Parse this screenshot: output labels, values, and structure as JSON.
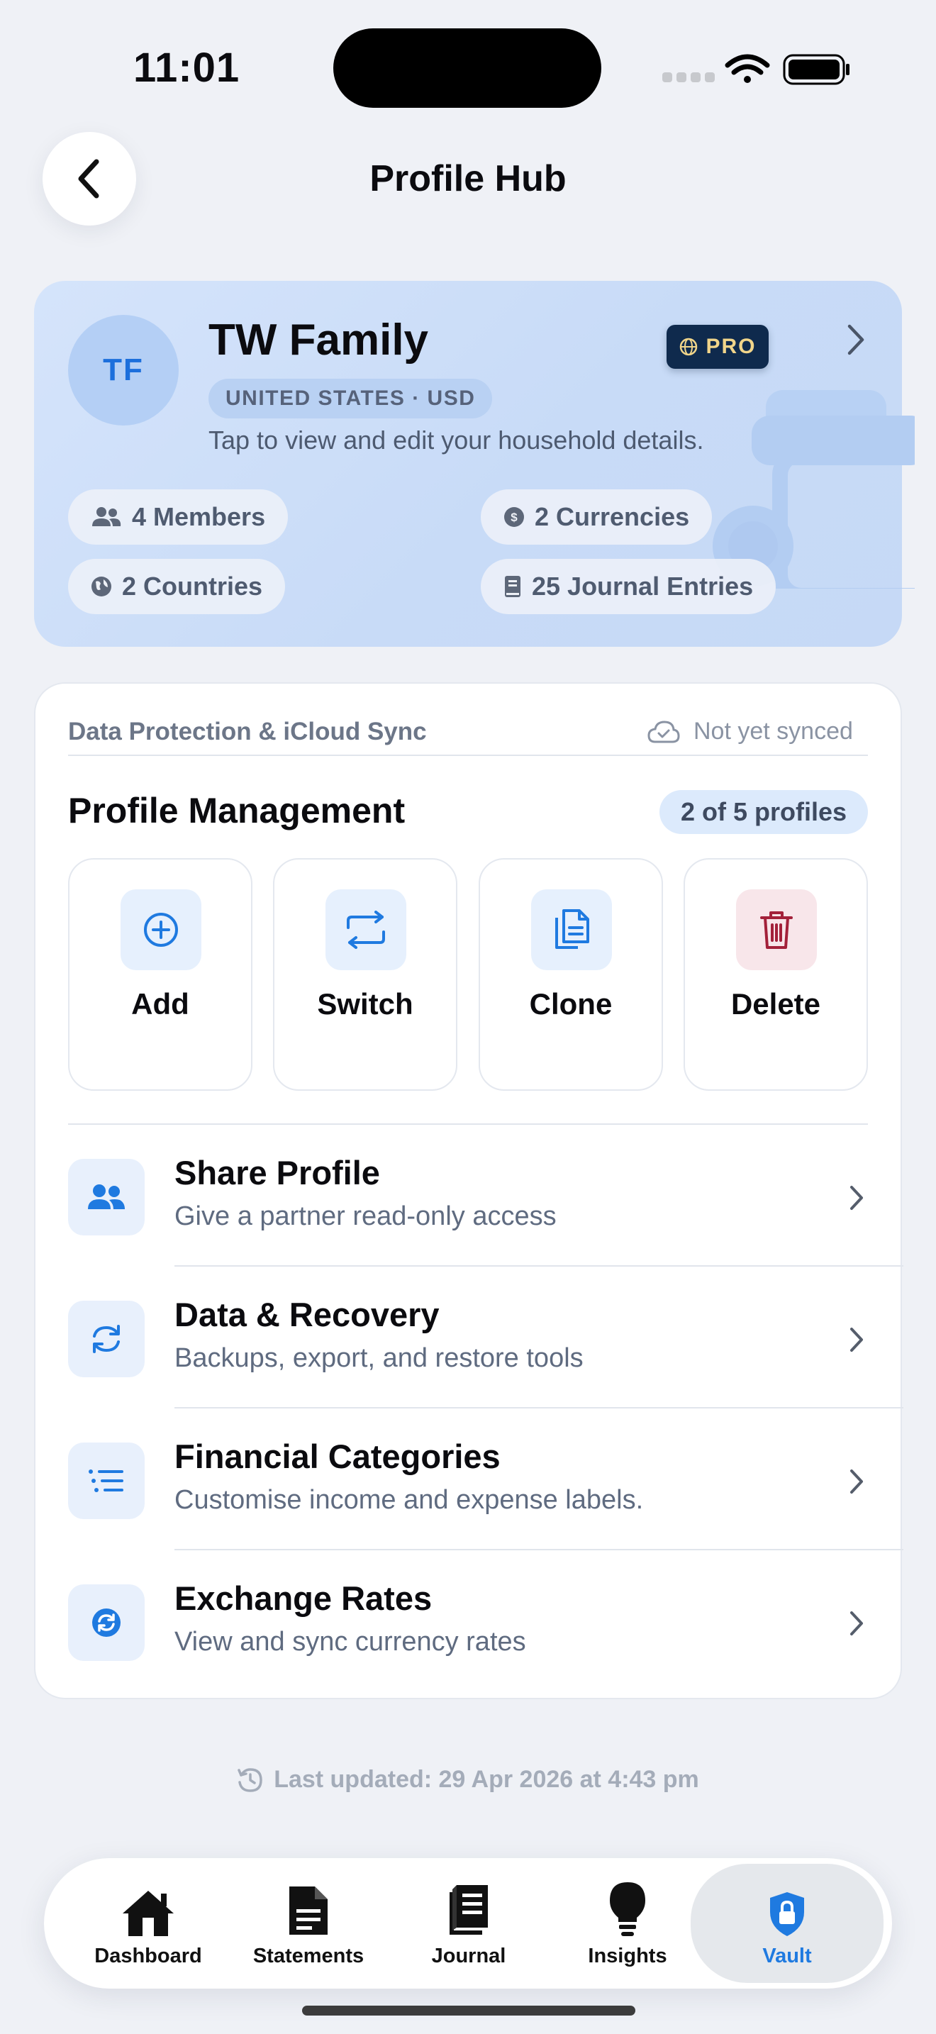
{
  "status_bar": {
    "time": "11:01"
  },
  "header": {
    "title": "Profile Hub"
  },
  "profile": {
    "initials": "TF",
    "name": "TW Family",
    "badge": "PRO",
    "locale": "UNITED STATES · USD",
    "description": "Tap to view and edit your household details.",
    "stats": {
      "members": "4 Members",
      "currencies": "2 Currencies",
      "countries": "2 Countries",
      "journal": "25 Journal Entries"
    }
  },
  "sync": {
    "label": "Data Protection & iCloud Sync",
    "status": "Not yet synced"
  },
  "management": {
    "title": "Profile Management",
    "count": "2 of 5 profiles",
    "actions": [
      {
        "label": "Add",
        "icon": "plus-circle-icon"
      },
      {
        "label": "Switch",
        "icon": "switch-arrows-icon"
      },
      {
        "label": "Clone",
        "icon": "clone-icon"
      },
      {
        "label": "Delete",
        "icon": "trash-icon"
      }
    ]
  },
  "menu": [
    {
      "title": "Share Profile",
      "subtitle": "Give a partner read-only access",
      "icon": "people-icon"
    },
    {
      "title": "Data & Recovery",
      "subtitle": "Backups, export, and restore tools",
      "icon": "sync-arrows-icon"
    },
    {
      "title": "Financial Categories",
      "subtitle": "Customise income and expense labels.",
      "icon": "list-icon"
    },
    {
      "title": "Exchange Rates",
      "subtitle": "View and sync currency rates",
      "icon": "currency-sync-icon"
    }
  ],
  "last_updated": "Last updated: 29 Apr 2026 at 4:43 pm",
  "tabs": [
    {
      "label": "Dashboard",
      "icon": "house-icon"
    },
    {
      "label": "Statements",
      "icon": "document-icon"
    },
    {
      "label": "Journal",
      "icon": "journal-icon"
    },
    {
      "label": "Insights",
      "icon": "lightbulb-icon"
    },
    {
      "label": "Vault",
      "icon": "lock-shield-icon"
    }
  ],
  "colors": {
    "accent": "#1f7ae0",
    "danger": "#a3213a",
    "background": "#eff1f6"
  }
}
